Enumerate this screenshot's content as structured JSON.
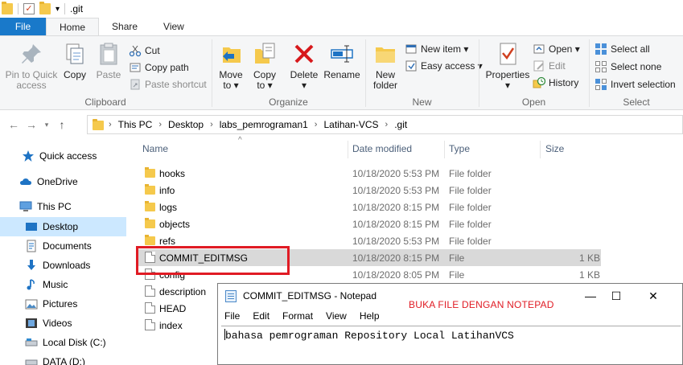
{
  "window": {
    "title": ".git"
  },
  "ribbon_tabs": [
    "File",
    "Home",
    "Share",
    "View"
  ],
  "ribbon": {
    "clipboard": {
      "label": "Clipboard",
      "pin_label_1": "Pin to Quick",
      "pin_label_2": "access",
      "copy_label": "Copy",
      "paste_label": "Paste",
      "cut_label": "Cut",
      "copy_path_label": "Copy path",
      "paste_shortcut_label": "Paste shortcut"
    },
    "organize": {
      "label": "Organize",
      "move_label_1": "Move",
      "move_label_2": "to ▾",
      "copy_label_1": "Copy",
      "copy_label_2": "to ▾",
      "delete_label_1": "Delete",
      "delete_label_2": "▾",
      "rename_label": "Rename"
    },
    "new": {
      "label": "New",
      "new_folder_label_1": "New",
      "new_folder_label_2": "folder",
      "new_item_label": "New item ▾",
      "easy_access_label": "Easy access ▾"
    },
    "open": {
      "label": "Open",
      "properties_label_1": "Properties",
      "properties_label_2": "▾",
      "open_label": "Open ▾",
      "edit_label": "Edit",
      "history_label": "History"
    },
    "select": {
      "label": "Select",
      "select_all_label": "Select all",
      "select_none_label": "Select none",
      "invert_label": "Invert selection"
    }
  },
  "address": {
    "crumbs": [
      "This PC",
      "Desktop",
      "labs_pemrograman1",
      "Latihan-VCS",
      ".git"
    ]
  },
  "nav": {
    "quick_access": "Quick access",
    "onedrive": "OneDrive",
    "this_pc": "This PC",
    "desktop": "Desktop",
    "documents": "Documents",
    "downloads": "Downloads",
    "music": "Music",
    "pictures": "Pictures",
    "videos": "Videos",
    "local_disk": "Local Disk (C:)",
    "data_disk": "DATA (D:)"
  },
  "columns": {
    "name": "Name",
    "date": "Date modified",
    "type": "Type",
    "size": "Size"
  },
  "files": [
    {
      "name": "hooks",
      "date": "10/18/2020 5:53 PM",
      "type": "File folder",
      "size": ""
    },
    {
      "name": "info",
      "date": "10/18/2020 5:53 PM",
      "type": "File folder",
      "size": ""
    },
    {
      "name": "logs",
      "date": "10/18/2020 8:15 PM",
      "type": "File folder",
      "size": ""
    },
    {
      "name": "objects",
      "date": "10/18/2020 8:15 PM",
      "type": "File folder",
      "size": ""
    },
    {
      "name": "refs",
      "date": "10/18/2020 5:53 PM",
      "type": "File folder",
      "size": ""
    },
    {
      "name": "COMMIT_EDITMSG",
      "date": "10/18/2020 8:15 PM",
      "type": "File",
      "size": "1 KB"
    },
    {
      "name": "config",
      "date": "10/18/2020 8:05 PM",
      "type": "File",
      "size": "1 KB"
    },
    {
      "name": "description",
      "date": "",
      "type": "",
      "size": ""
    },
    {
      "name": "HEAD",
      "date": "",
      "type": "",
      "size": ""
    },
    {
      "name": "index",
      "date": "",
      "type": "",
      "size": ""
    }
  ],
  "notepad": {
    "title": "COMMIT_EDITMSG - Notepad",
    "menu": [
      "File",
      "Edit",
      "Format",
      "View",
      "Help"
    ],
    "annotation": "BUKA FILE DENGAN NOTEPAD",
    "content": "bahasa pemrograman Repository Local LatihanVCS",
    "minimize": "—",
    "maximize": "☐",
    "close": "✕"
  },
  "colors": {
    "file_tab": "#1979ca",
    "selected_nav": "#cce8ff",
    "highlight_row": "#d9d9d9",
    "annotation_red": "#e01b24"
  }
}
